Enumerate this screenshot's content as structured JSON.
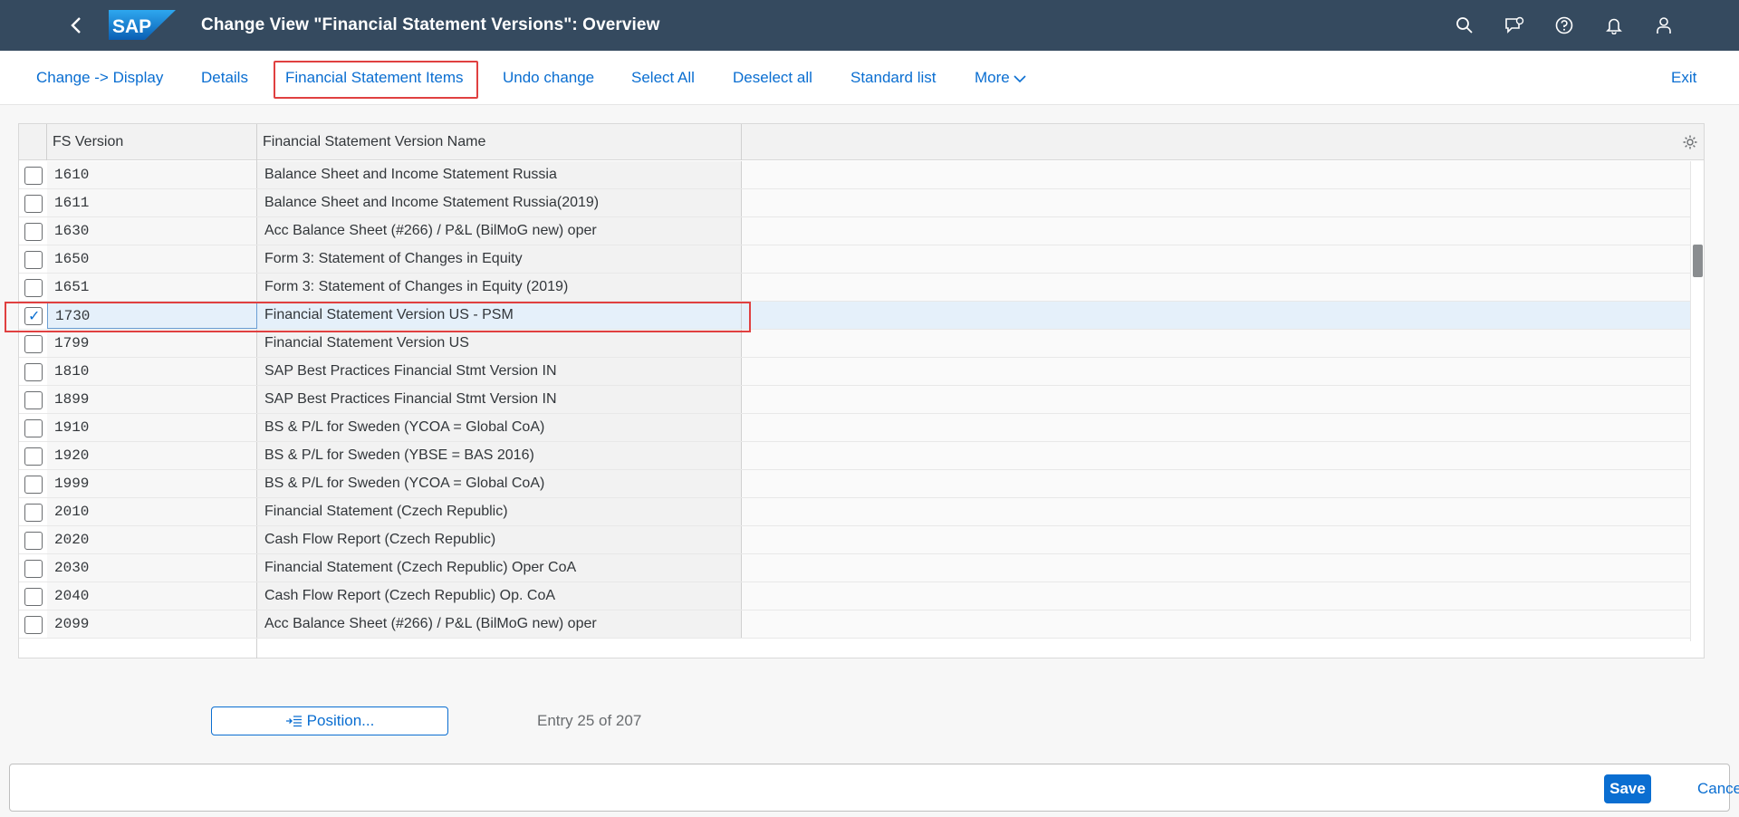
{
  "shell": {
    "title": "Change View \"Financial Statement Versions\": Overview",
    "logo_text": "SAP",
    "icons": [
      "back-icon",
      "search-icon",
      "feedback-icon",
      "help-icon",
      "notifications-icon",
      "user-icon"
    ]
  },
  "toolbar": {
    "change_display": "Change -> Display",
    "details": "Details",
    "fs_items": "Financial Statement Items",
    "undo_change": "Undo change",
    "select_all": "Select All",
    "deselect_all": "Deselect all",
    "standard_list": "Standard list",
    "more": "More",
    "exit": "Exit"
  },
  "table": {
    "columns": [
      "FS Version",
      "Financial Statement Version Name"
    ],
    "rows": [
      {
        "code": "1610",
        "name": "Balance Sheet and Income Statement Russia",
        "checked": false
      },
      {
        "code": "1611",
        "name": "Balance Sheet and Income Statement Russia(2019)",
        "checked": false
      },
      {
        "code": "1630",
        "name": "Acc Balance Sheet (#266) / P&L (BilMoG new) oper",
        "checked": false
      },
      {
        "code": "1650",
        "name": "Form 3: Statement of Changes in Equity",
        "checked": false
      },
      {
        "code": "1651",
        "name": "Form 3: Statement of Changes in Equity (2019)",
        "checked": false
      },
      {
        "code": "1730",
        "name": "Financial Statement Version US - PSM",
        "checked": true
      },
      {
        "code": "1799",
        "name": "Financial Statement Version US",
        "checked": false
      },
      {
        "code": "1810",
        "name": "SAP Best Practices Financial Stmt Version IN",
        "checked": false
      },
      {
        "code": "1899",
        "name": "SAP Best Practices Financial Stmt Version IN",
        "checked": false
      },
      {
        "code": "1910",
        "name": "BS & P/L for Sweden (YCOA = Global CoA)",
        "checked": false
      },
      {
        "code": "1920",
        "name": "BS & P/L for Sweden (YBSE = BAS 2016)",
        "checked": false
      },
      {
        "code": "1999",
        "name": "BS & P/L for Sweden (YCOA = Global CoA)",
        "checked": false
      },
      {
        "code": "2010",
        "name": "Financial Statement (Czech Republic)",
        "checked": false
      },
      {
        "code": "2020",
        "name": "Cash Flow Report (Czech Republic)",
        "checked": false
      },
      {
        "code": "2030",
        "name": "Financial Statement (Czech Republic) Oper CoA",
        "checked": false
      },
      {
        "code": "2040",
        "name": "Cash Flow Report (Czech Republic) Op. CoA",
        "checked": false
      },
      {
        "code": "2099",
        "name": "Acc Balance Sheet (#266) / P&L (BilMoG new) oper",
        "checked": false
      }
    ]
  },
  "position_button": "Position...",
  "entry_info": "Entry 25 of 207",
  "footer": {
    "save": "Save",
    "cancel": "Cancel"
  },
  "colors": {
    "shell_bg": "#354a5f",
    "link": "#0a6ed1",
    "highlight_box": "#e04040",
    "selected_row": "#e5f0fa"
  }
}
